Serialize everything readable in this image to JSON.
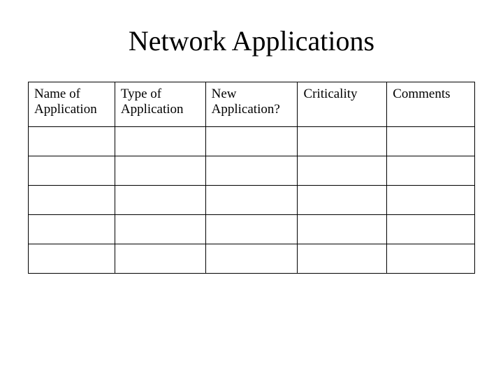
{
  "title": "Network Applications",
  "table": {
    "headers": [
      "Name of Application",
      "Type of Application",
      "New Application?",
      "Criticality",
      "Comments"
    ],
    "rows": [
      [
        "",
        "",
        "",
        "",
        ""
      ],
      [
        "",
        "",
        "",
        "",
        ""
      ],
      [
        "",
        "",
        "",
        "",
        ""
      ],
      [
        "",
        "",
        "",
        "",
        ""
      ],
      [
        "",
        "",
        "",
        "",
        ""
      ]
    ]
  }
}
